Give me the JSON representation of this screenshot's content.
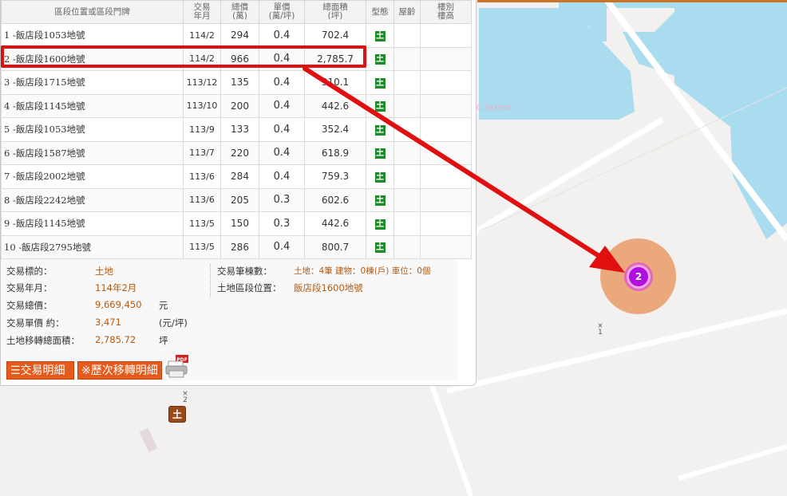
{
  "table": {
    "headers": [
      "區段位置或區段門牌",
      "交易\n年月",
      "總價\n(萬)",
      "單價\n(萬/坪)",
      "總面積\n(坪)",
      "型態",
      "屋齡",
      "樓別\n樓高"
    ],
    "rows": [
      {
        "addr": "1  -飯店段1053地號",
        "ym": "114/2",
        "total": "294",
        "unit": "0.4",
        "area": "702.4",
        "type": "土"
      },
      {
        "addr": "2  -飯店段1600地號",
        "ym": "114/2",
        "total": "966",
        "unit": "0.4",
        "area": "2,785.7",
        "type": "土"
      },
      {
        "addr": "3  -飯店段1715地號",
        "ym": "113/12",
        "total": "135",
        "unit": "0.4",
        "area": "310.1",
        "type": "土"
      },
      {
        "addr": "4  -飯店段1145地號",
        "ym": "113/10",
        "total": "200",
        "unit": "0.4",
        "area": "442.6",
        "type": "土"
      },
      {
        "addr": "5  -飯店段1053地號",
        "ym": "113/9",
        "total": "133",
        "unit": "0.4",
        "area": "352.4",
        "type": "土"
      },
      {
        "addr": "6  -飯店段1587地號",
        "ym": "113/7",
        "total": "220",
        "unit": "0.4",
        "area": "618.9",
        "type": "土"
      },
      {
        "addr": "7  -飯店段2002地號",
        "ym": "113/6",
        "total": "284",
        "unit": "0.4",
        "area": "759.3",
        "type": "土"
      },
      {
        "addr": "8  -飯店段2242地號",
        "ym": "113/6",
        "total": "205",
        "unit": "0.3",
        "area": "602.6",
        "type": "土"
      },
      {
        "addr": "9  -飯店段1145地號",
        "ym": "113/5",
        "total": "150",
        "unit": "0.3",
        "area": "442.6",
        "type": "土"
      },
      {
        "addr": "10  -飯店段2795地號",
        "ym": "113/5",
        "total": "286",
        "unit": "0.4",
        "area": "800.7",
        "type": "土"
      }
    ]
  },
  "detail": {
    "target_label": "交易標的：",
    "target_value": "土地",
    "ym_label": "交易年月：",
    "ym_value": "114年2月",
    "total_label": "交易總價：",
    "total_value": "9,669,450",
    "total_unit": "元",
    "unitprice_label": "交易單價 約：",
    "unitprice_value": "3,471",
    "unitprice_unit": "(元/坪)",
    "area_label": "土地移轉總面積：",
    "area_value": "2,785.72",
    "area_unit": "坪",
    "count_label": "交易筆棟數：",
    "count_value": "土地：4筆 建物：0棟(戶) 車位：0個",
    "location_label": "土地區段位置：",
    "location_value": "飯店段1600地號"
  },
  "buttons": {
    "detail": "☰交易明細",
    "history": "※歷次移轉明細",
    "pdf": "PDF"
  },
  "map": {
    "watermark": "C 202502",
    "land_marker": "土",
    "cluster_count": "2",
    "xmark_1": "1",
    "xmark_2": "2"
  }
}
